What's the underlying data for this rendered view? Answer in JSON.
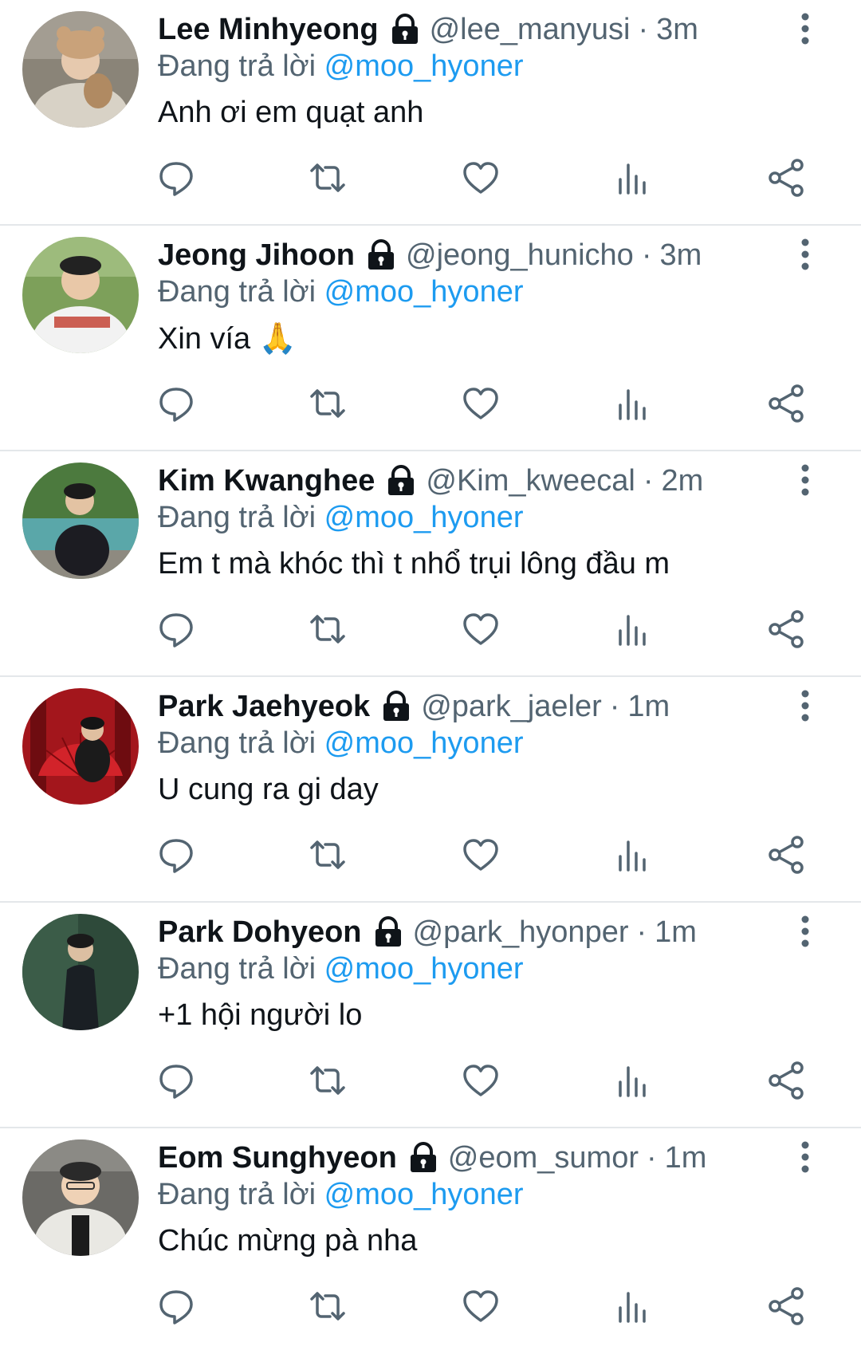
{
  "reply_prefix": "Đang trả lời",
  "icons": {
    "reply": "reply-icon",
    "retweet": "retweet-icon",
    "like": "heart-icon",
    "views": "views-icon",
    "share": "share-icon",
    "more": "more-vertical-icon",
    "lock": "lock-icon"
  },
  "colors": {
    "mention": "#1d9bf0",
    "secondary_text": "#536471",
    "primary_text": "#0f1419"
  },
  "tweets": [
    {
      "name": "Lee Minhyeong",
      "handle": "@lee_manyusi",
      "separator": "·",
      "time": "3m",
      "reply_to": "@moo_hyoner",
      "text": "Anh ơi em quạt anh"
    },
    {
      "name": "Jeong Jihoon",
      "handle": "@jeong_hunicho",
      "separator": "·",
      "time": "3m",
      "reply_to": "@moo_hyoner",
      "text": "Xin vía 🙏"
    },
    {
      "name": "Kim Kwanghee",
      "handle": "@Kim_kweecal",
      "separator": "·",
      "time": "2m",
      "reply_to": "@moo_hyoner",
      "text": "Em t mà khóc thì t nhổ trụi lông đầu m"
    },
    {
      "name": "Park Jaehyeok",
      "handle": "@park_jaeler",
      "separator": "·",
      "time": "1m",
      "reply_to": "@moo_hyoner",
      "text": "U cung ra gi day"
    },
    {
      "name": "Park Dohyeon",
      "handle": "@park_hyonper",
      "separator": "·",
      "time": "1m",
      "reply_to": "@moo_hyoner",
      "text": "+1 hội người lo"
    },
    {
      "name": "Eom Sunghyeon",
      "handle": "@eom_sumor",
      "separator": "·",
      "time": "1m",
      "reply_to": "@moo_hyoner",
      "text": "Chúc mừng pà nha"
    }
  ]
}
